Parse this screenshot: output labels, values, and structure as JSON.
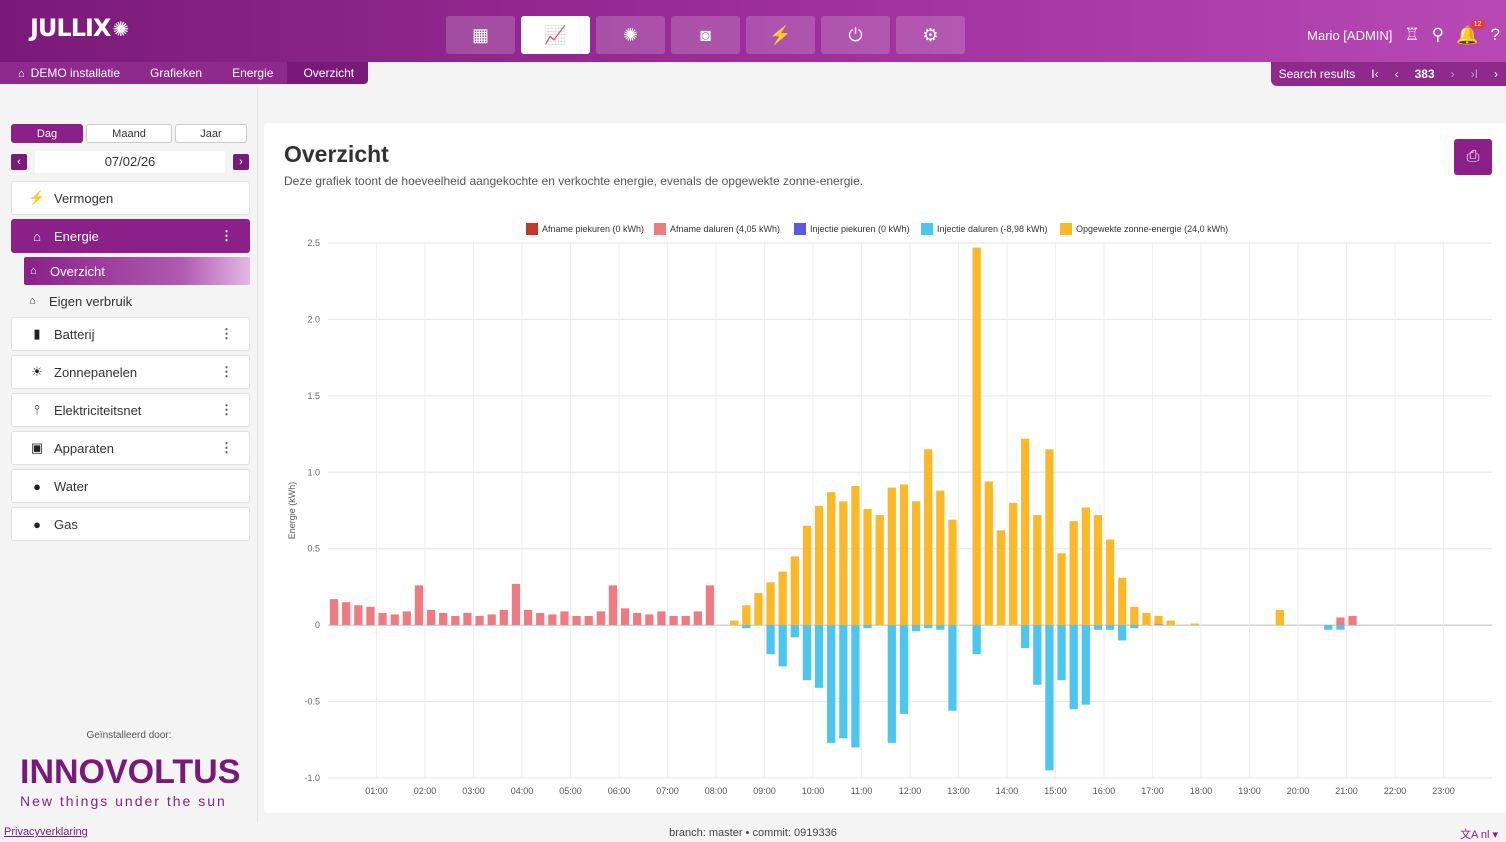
{
  "app": {
    "logo": "JULLIX"
  },
  "topnav": [
    {
      "name": "dashboard-icon",
      "glyph": "▦"
    },
    {
      "name": "chart-icon",
      "glyph": "📈",
      "active": true
    },
    {
      "name": "brain-icon",
      "glyph": "✺"
    },
    {
      "name": "money-icon",
      "glyph": "◙"
    },
    {
      "name": "ev-charger-icon",
      "glyph": "⚡"
    },
    {
      "name": "plug-icon",
      "glyph": "⏻"
    },
    {
      "name": "gear-icon",
      "glyph": "⚙"
    }
  ],
  "user": {
    "name": "Mario [ADMIN]",
    "notifications": "12"
  },
  "breadcrumbs": [
    "DEMO installatie",
    "Grafieken",
    "Energie",
    "Overzicht"
  ],
  "search": {
    "label": "Search results",
    "first": "I‹",
    "prev": "‹",
    "count": "383",
    "next": "›",
    "last": "›I",
    "close": "›"
  },
  "sidebar": {
    "period_tabs": [
      "Dag",
      "Maand",
      "Jaar"
    ],
    "date": "07/02/26",
    "prev": "‹",
    "next": "›",
    "items": [
      {
        "label": "Vermogen",
        "icon": "⚡"
      },
      {
        "label": "Energie",
        "icon": "⌂",
        "active": true,
        "menu": "⋮"
      },
      {
        "label": "Batterij",
        "icon": "▮",
        "menu": "⋮"
      },
      {
        "label": "Zonnepanelen",
        "icon": "☀",
        "menu": "⋮"
      },
      {
        "label": "Elektriciteitsnet",
        "icon": "⫯",
        "menu": "⋮"
      },
      {
        "label": "Apparaten",
        "icon": "▣",
        "menu": "⋮"
      },
      {
        "label": "Water",
        "icon": "●"
      },
      {
        "label": "Gas",
        "icon": "●"
      }
    ],
    "subitems": [
      {
        "label": "Overzicht",
        "icon": "⌂",
        "active": true
      },
      {
        "label": "Eigen verbruik",
        "icon": "⌂"
      }
    ],
    "installer_label": "Geïnstalleerd door:",
    "installer_brand": "INNOVOLTUS",
    "installer_tagline": "New things under the sun"
  },
  "main": {
    "title": "Overzicht",
    "description": "Deze grafiek toont de hoeveelheid aangekochte en verkochte energie, evenals de opgewekte zonne-energie."
  },
  "chart_data": {
    "type": "bar",
    "ylabel": "Energie (kWh)",
    "ylim": [
      -1.0,
      2.5
    ],
    "yticks": [
      2.5,
      2.0,
      1.5,
      1.0,
      0.5,
      0,
      -0.5,
      -1.0
    ],
    "xtick_labels": [
      "01:00",
      "02:00",
      "03:00",
      "04:00",
      "05:00",
      "06:00",
      "07:00",
      "08:00",
      "09:00",
      "10:00",
      "11:00",
      "12:00",
      "13:00",
      "14:00",
      "15:00",
      "16:00",
      "17:00",
      "18:00",
      "19:00",
      "20:00",
      "21:00",
      "22:00",
      "23:00"
    ],
    "legend": [
      {
        "name": "Afname piekuren (0 kWh)",
        "color": "#c0392b"
      },
      {
        "name": "Afname daluren (4,05 kWh)",
        "color": "#ee7b82"
      },
      {
        "name": "Injectie piekuren (0 kWh)",
        "color": "#5a5ae0"
      },
      {
        "name": "Injectie daluren (-8,98 kWh)",
        "color": "#4cc6ef"
      },
      {
        "name": "Opgewekte zonne-energie (24,0 kWh)",
        "color": "#fbb929"
      }
    ],
    "interval_minutes": 15,
    "afname_daluren": [
      0.17,
      0.15,
      0.13,
      0.12,
      0.08,
      0.07,
      0.09,
      0.26,
      0.1,
      0.08,
      0.06,
      0.08,
      0.06,
      0.07,
      0.1,
      0.27,
      0.1,
      0.08,
      0.07,
      0.09,
      0.06,
      0.06,
      0.09,
      0.26,
      0.11,
      0.08,
      0.07,
      0.09,
      0.06,
      0.06,
      0.09,
      0.26,
      0,
      0,
      0,
      0,
      0,
      0,
      0,
      0,
      0,
      0,
      0,
      0,
      0,
      0,
      0,
      0,
      0,
      0,
      0,
      0,
      0,
      0,
      0,
      0,
      0,
      0,
      0,
      0,
      0,
      0,
      0,
      0,
      0,
      0,
      0,
      0,
      0.01,
      0,
      0,
      0,
      0,
      0,
      0,
      0,
      0,
      0,
      0,
      0,
      0,
      0,
      0,
      0.05,
      0.06,
      0,
      0,
      0,
      0,
      0,
      0,
      0,
      0,
      0,
      0,
      0
    ],
    "opgewekte_zonne_energie": [
      0,
      0,
      0,
      0,
      0,
      0,
      0,
      0,
      0,
      0,
      0,
      0,
      0,
      0,
      0,
      0,
      0,
      0,
      0,
      0,
      0,
      0,
      0,
      0,
      0,
      0,
      0,
      0,
      0,
      0,
      0,
      0,
      0,
      0.03,
      0.13,
      0.21,
      0.28,
      0.35,
      0.45,
      0.65,
      0.78,
      0.87,
      0.81,
      0.91,
      0.76,
      0.72,
      0.9,
      0.92,
      0.81,
      1.15,
      0.88,
      0.69,
      0,
      2.47,
      0.94,
      0.62,
      0.8,
      1.22,
      0.72,
      1.15,
      0.47,
      0.68,
      0.77,
      0.72,
      0.56,
      0.31,
      0.12,
      0.08,
      0.05,
      0.03,
      0,
      0.01,
      0,
      0,
      0,
      0,
      0,
      0,
      0.1,
      0,
      0,
      0,
      0,
      0,
      0,
      0,
      0,
      0,
      0,
      0,
      0,
      0,
      0,
      0,
      0,
      0
    ],
    "injectie_daluren": [
      0,
      0,
      0,
      0,
      0,
      0,
      0,
      0,
      0,
      0,
      0,
      0,
      0,
      0,
      0,
      0,
      0,
      0,
      0,
      0,
      0,
      0,
      0,
      0,
      0,
      0,
      0,
      0,
      0,
      0,
      0,
      0,
      0,
      0,
      -0.02,
      0,
      -0.19,
      -0.27,
      -0.08,
      -0.36,
      -0.41,
      -0.77,
      -0.74,
      -0.8,
      -0.02,
      0,
      -0.77,
      -0.58,
      -0.04,
      -0.02,
      -0.03,
      -0.56,
      0,
      -0.19,
      0,
      0,
      0,
      -0.15,
      -0.39,
      -0.95,
      -0.36,
      -0.55,
      -0.52,
      -0.03,
      -0.03,
      -0.1,
      -0.02,
      0,
      0,
      0,
      0,
      0,
      0,
      0,
      0,
      0,
      0,
      0,
      0,
      0,
      0,
      0,
      -0.03,
      -0.03,
      0,
      0,
      0,
      0,
      0,
      0,
      0,
      0,
      0,
      0,
      0,
      0
    ]
  },
  "footer": {
    "privacy": "Privacyverklaring",
    "build": "branch: master • commit: 0919336",
    "language": "文A nl ▾"
  }
}
